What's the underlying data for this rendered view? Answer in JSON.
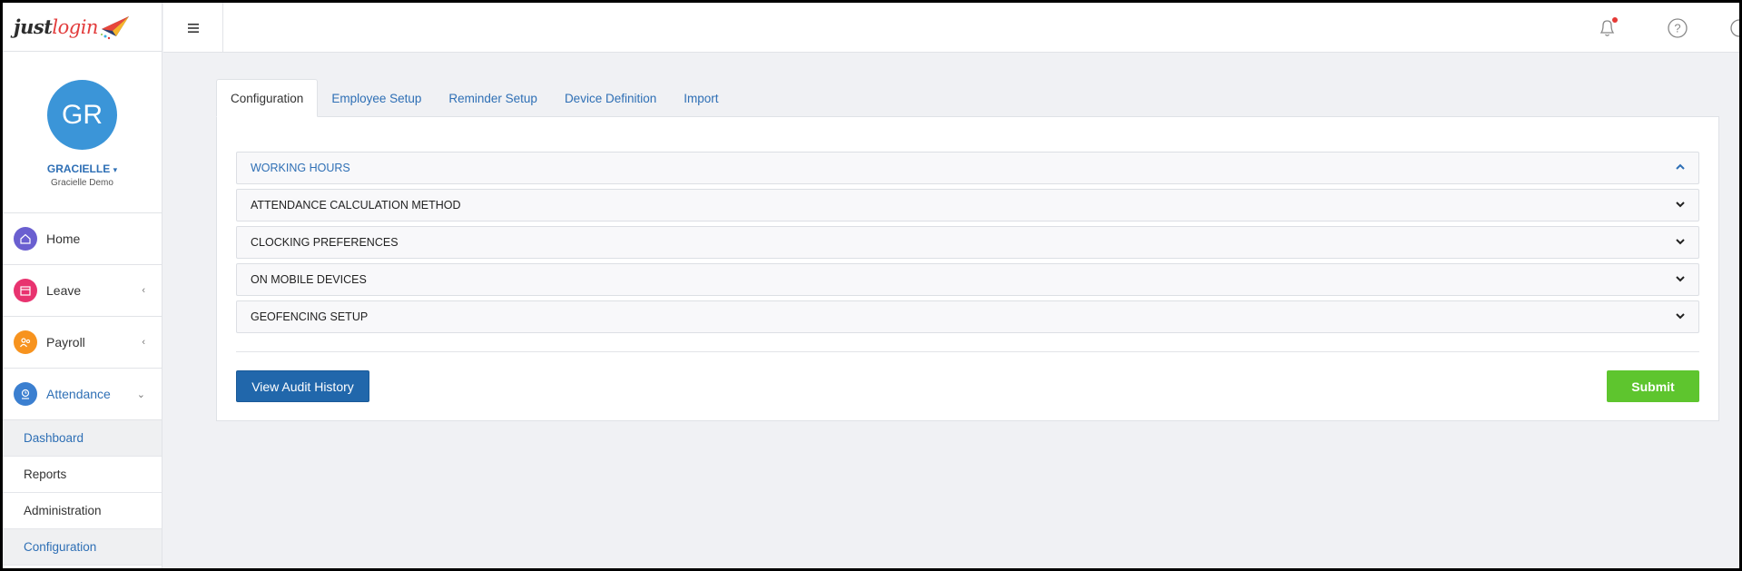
{
  "logo": {
    "part1": "just",
    "part2": "login"
  },
  "profile": {
    "initials": "GR",
    "name": "GRACIELLE",
    "subtitle": "Gracielle Demo"
  },
  "nav": [
    {
      "label": "Home",
      "icon": "home-icon",
      "color": "#6a5fd0"
    },
    {
      "label": "Leave",
      "icon": "calendar-icon",
      "color": "#e8336f"
    },
    {
      "label": "Payroll",
      "icon": "users-icon",
      "color": "#f7931e"
    },
    {
      "label": "Attendance",
      "icon": "clock-user-icon",
      "color": "#3b7fd0"
    }
  ],
  "subnav": [
    "Dashboard",
    "Reports",
    "Administration",
    "Configuration"
  ],
  "tabs": [
    "Configuration",
    "Employee Setup",
    "Reminder Setup",
    "Device Definition",
    "Import"
  ],
  "sections": [
    "WORKING HOURS",
    "ATTENDANCE CALCULATION METHOD",
    "CLOCKING PREFERENCES",
    "ON MOBILE DEVICES",
    "GEOFENCING SETUP"
  ],
  "buttons": {
    "audit": "View Audit History",
    "submit": "Submit"
  },
  "colors": {
    "accent": "#2e6fb5",
    "submit": "#5ec52e",
    "primary_button": "#2167ab",
    "notification_dot": "#e53935"
  }
}
